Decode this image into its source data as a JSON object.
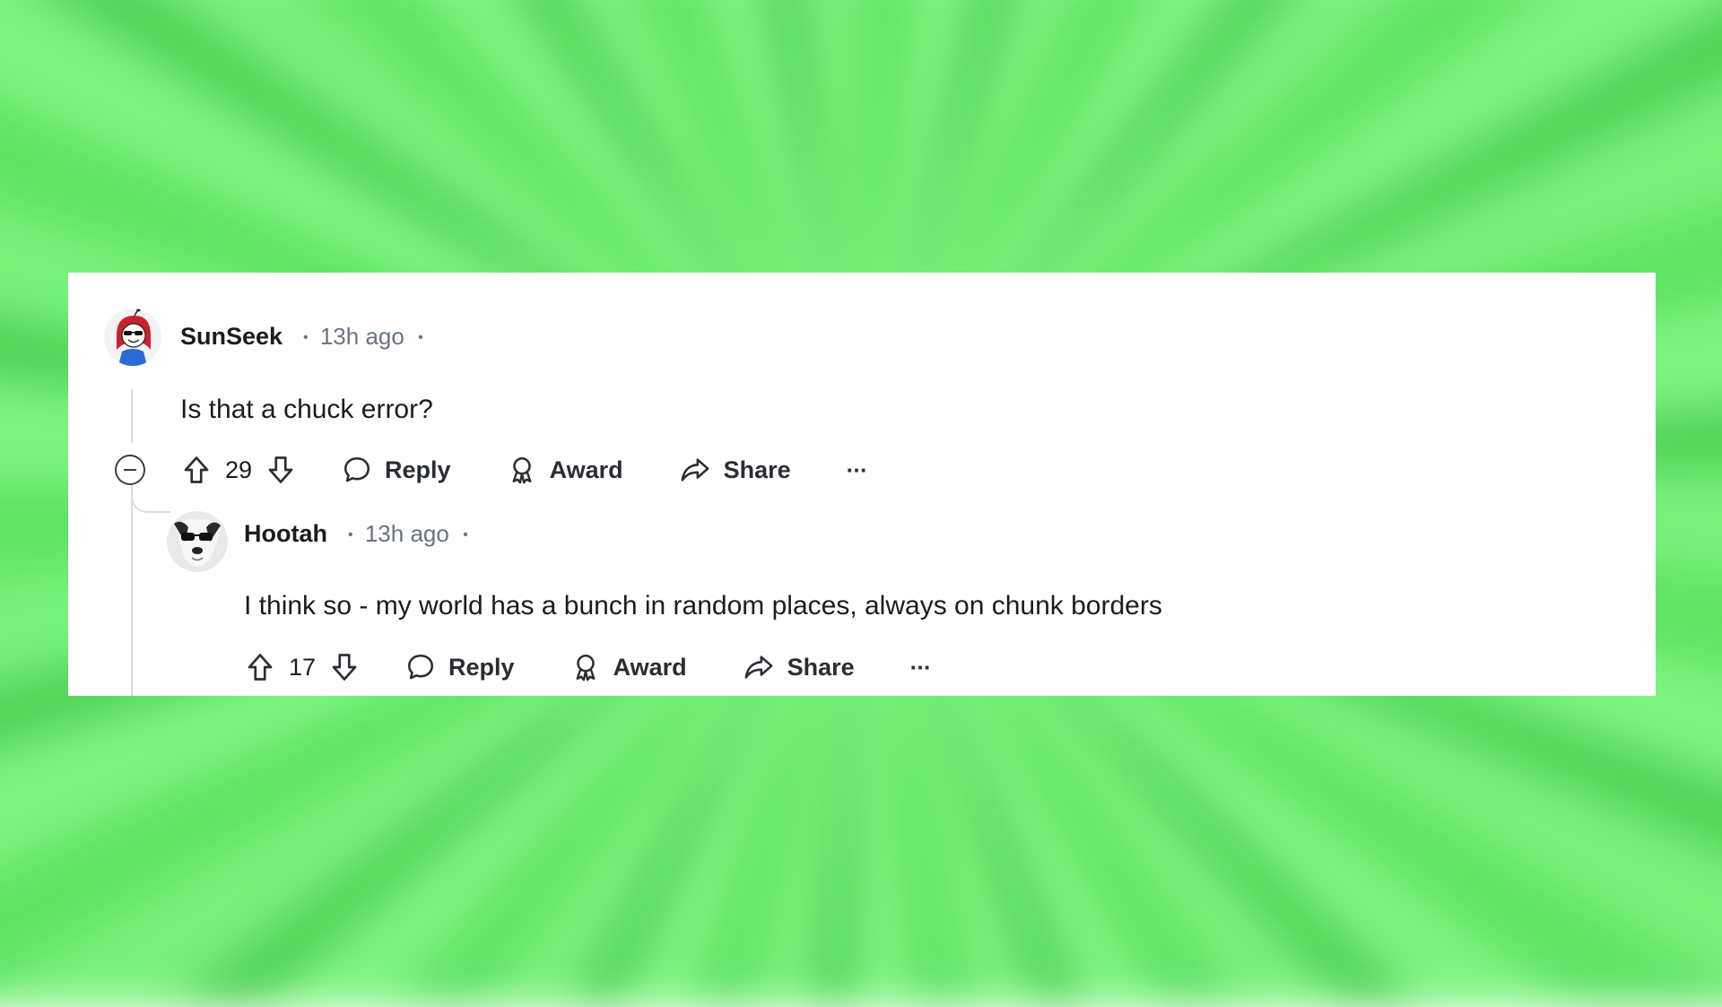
{
  "comments": [
    {
      "author": "SunSeek",
      "time": "13h ago",
      "dot": "•",
      "body": "Is that a chuck error?",
      "votes": "29",
      "actions": {
        "reply": "Reply",
        "award": "Award",
        "share": "Share",
        "more": "···"
      }
    },
    {
      "author": "Hootah",
      "time": "13h ago",
      "dot": "•",
      "body": "I think so - my world has a bunch in random places, always on chunk borders",
      "votes": "17",
      "actions": {
        "reply": "Reply",
        "award": "Award",
        "share": "Share",
        "more": "···"
      }
    }
  ],
  "icons": {
    "upvote": "arrow-up-icon",
    "downvote": "arrow-down-icon",
    "reply": "speech-bubble-icon",
    "award": "ribbon-award-icon",
    "share": "share-arrow-icon",
    "collapse": "minus-circle-icon"
  },
  "colors": {
    "background": "#6ff06f",
    "card": "#ffffff",
    "text": "#1c1c1c",
    "muted": "#6a7480"
  }
}
